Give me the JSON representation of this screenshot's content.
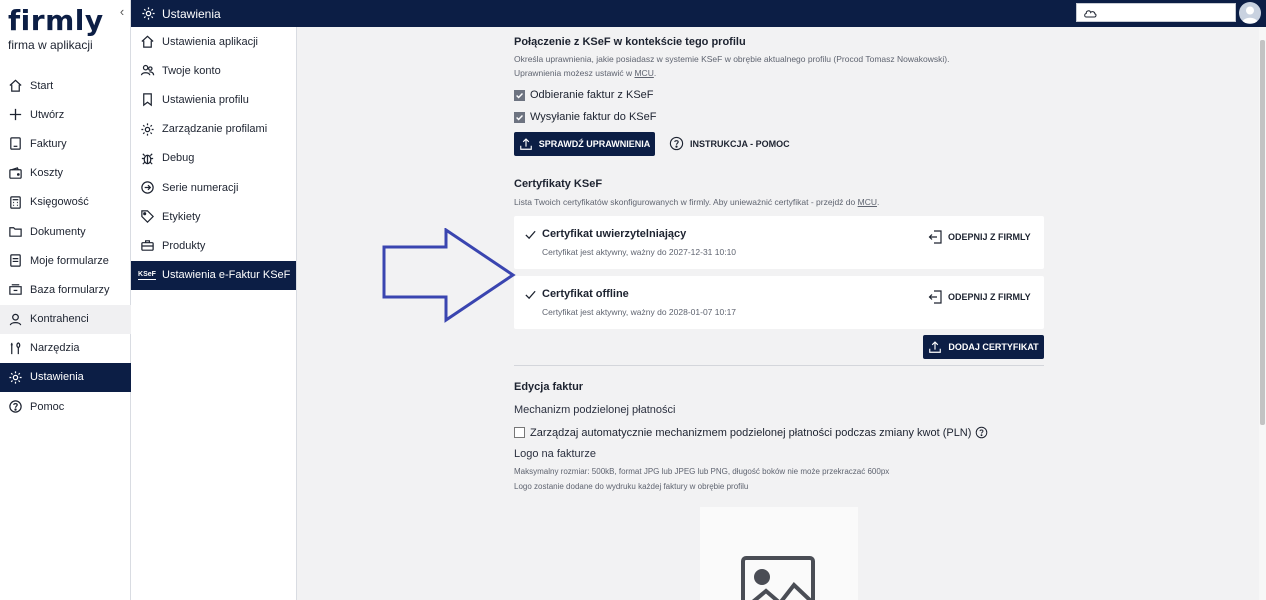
{
  "brand": {
    "name": "firmly",
    "tagline": "firma w aplikacji"
  },
  "topbar": {
    "title": "Ustawienia"
  },
  "nav": [
    {
      "label": "Start",
      "icon": "home-icon"
    },
    {
      "label": "Utwórz",
      "icon": "plus-icon"
    },
    {
      "label": "Faktury",
      "icon": "invoice-icon"
    },
    {
      "label": "Koszty",
      "icon": "wallet-icon"
    },
    {
      "label": "Księgowość",
      "icon": "calculator-icon"
    },
    {
      "label": "Dokumenty",
      "icon": "folder-icon"
    },
    {
      "label": "Moje formularze",
      "icon": "form-icon"
    },
    {
      "label": "Baza formularzy",
      "icon": "archive-icon"
    },
    {
      "label": "Kontrahenci",
      "icon": "user-icon"
    },
    {
      "label": "Narzędzia",
      "icon": "tools-icon"
    },
    {
      "label": "Ustawienia",
      "icon": "gear-icon"
    },
    {
      "label": "Pomoc",
      "icon": "question-icon"
    }
  ],
  "submenu": [
    {
      "label": "Ustawienia aplikacji",
      "icon": "home-icon"
    },
    {
      "label": "Twoje konto",
      "icon": "users-icon"
    },
    {
      "label": "Ustawienia profilu",
      "icon": "bookmark-icon"
    },
    {
      "label": "Zarządzanie profilami",
      "icon": "gear-icon"
    },
    {
      "label": "Debug",
      "icon": "bug-icon"
    },
    {
      "label": "Serie numeracji",
      "icon": "arrow-circle-icon"
    },
    {
      "label": "Etykiety",
      "icon": "tag-icon"
    },
    {
      "label": "Produkty",
      "icon": "briefcase-icon"
    },
    {
      "label": "Ustawienia e-Faktur KSeF",
      "icon": "ksef-icon",
      "badge": "KSeF"
    }
  ],
  "ksef_connection": {
    "title": "Połączenie z KSeF w kontekście tego profilu",
    "desc_line1": "Określa uprawnienia, jakie posiadasz w systemie KSeF w obrębie aktualnego profilu (Procod Tomasz Nowakowski).",
    "desc_line2_prefix": "Uprawnienia możesz ustawić w ",
    "desc_line2_link": "MCU",
    "desc_line2_suffix": ".",
    "checkbox_receive": "Odbieranie faktur z KSeF",
    "checkbox_send": "Wysyłanie faktur do KSeF",
    "check_button": "SPRAWDŹ UPRAWNIENIA",
    "help_link": "INSTRUKCJA - POMOC"
  },
  "certificates": {
    "title": "Certyfikaty KSeF",
    "desc_prefix": "Lista Twoich certyfikatów skonfigurowanych w firmly. Aby unieważnić certyfikat - przejdź do ",
    "desc_link": "MCU",
    "desc_suffix": ".",
    "items": [
      {
        "title": "Certyfikat uwierzytelniający",
        "subtitle": "Certyfikat jest aktywny, ważny do 2027-12-31 10:10",
        "action": "ODEPNIJ Z FIRMLY"
      },
      {
        "title": "Certyfikat offline",
        "subtitle": "Certyfikat jest aktywny, ważny do 2028-01-07 10:17",
        "action": "ODEPNIJ Z FIRMLY"
      }
    ],
    "add_button": "DODAJ CERTYFIKAT"
  },
  "invoice_edit": {
    "title": "Edycja faktur",
    "split_payment_label": "Mechanizm podzielonej płatności",
    "split_payment_checkbox": "Zarządzaj automatycznie mechanizmem podzielonej płatności podczas zmiany kwot (PLN)",
    "logo_label": "Logo na fakturze",
    "logo_hint1": "Maksymalny rozmiar: 500kB, format JPG lub JPEG lub PNG, długość boków nie może przekraczać 600px",
    "logo_hint2": "Logo zostanie dodane do wydruku każdej faktury w obrębie profilu"
  },
  "colors": {
    "navy": "#0c1e45",
    "annotation_arrow": "#3a45b0",
    "background": "#f2f2f3"
  }
}
